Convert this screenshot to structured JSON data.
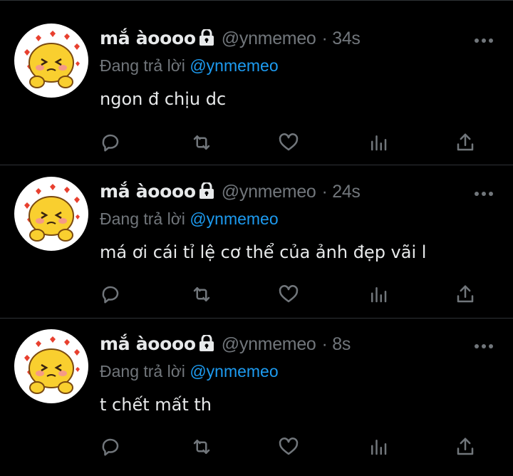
{
  "tweets": [
    {
      "name": "mắ àoooo",
      "handle": "@ynmemeo",
      "time": "· 34s",
      "reply_prefix": "Đang trả lời ",
      "reply_to": "@ynmemeo",
      "text": "ngon đ chịu dc"
    },
    {
      "name": "mắ àoooo",
      "handle": "@ynmemeo",
      "time": "· 24s",
      "reply_prefix": "Đang trả lời ",
      "reply_to": "@ynmemeo",
      "text": "má ơi cái tỉ lệ cơ thể của ảnh đẹp vãi l"
    },
    {
      "name": "mắ àoooo",
      "handle": "@ynmemeo",
      "time": "· 8s",
      "reply_prefix": "Đang trả lời ",
      "reply_to": "@ynmemeo",
      "text": "t chết mất th"
    }
  ],
  "icons": {
    "lock": "lock-icon",
    "more": "more-dots-icon",
    "reply": "reply-icon",
    "retweet": "retweet-icon",
    "like": "heart-icon",
    "views": "analytics-icon",
    "share": "share-icon"
  },
  "colors": {
    "background": "#000000",
    "text": "#e7e9ea",
    "secondary": "#71767b",
    "mention": "#1d9bf0",
    "divider": "#2f3336"
  }
}
